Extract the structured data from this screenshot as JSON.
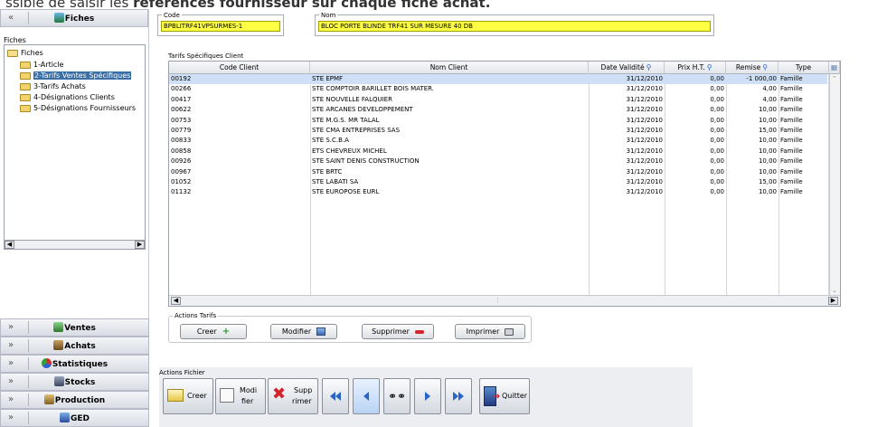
{
  "caption": {
    "prefix": "ssible de saisir les",
    "bold": "références fournisseur",
    "suffix": " sur chaque fiche achat."
  },
  "sidebar": {
    "top_section": {
      "title": "Fiches",
      "chevron": "«"
    },
    "tree_label": "Fiches",
    "tree": {
      "root": "Fiches",
      "items": [
        {
          "label": "1-Article"
        },
        {
          "label": "2-Tarifs Ventes Spécifiques",
          "selected": true
        },
        {
          "label": "3-Tarifs Achats"
        },
        {
          "label": "4-Désignations Clients"
        },
        {
          "label": "5-Désignations Fournisseurs"
        }
      ]
    },
    "sections": [
      {
        "title": "Ventes",
        "chevron": "»",
        "icon": "sales-icon"
      },
      {
        "title": "Achats",
        "chevron": "»",
        "icon": "purchases-icon"
      },
      {
        "title": "Statistiques",
        "chevron": "»",
        "icon": "stats-icon"
      },
      {
        "title": "Stocks",
        "chevron": "»",
        "icon": "stocks-icon"
      },
      {
        "title": "Production",
        "chevron": "»",
        "icon": "production-icon"
      },
      {
        "title": "GED",
        "chevron": "»",
        "icon": "ged-icon"
      }
    ]
  },
  "form": {
    "code": {
      "label": "Code",
      "value": "BPBLITRF41VPSURMES-1"
    },
    "nom": {
      "label": "Nom",
      "value": "BLOC PORTE BLINDE TRF41 SUR MESURE 40 DB"
    }
  },
  "grid": {
    "title": "Tarifs Spécifiques Client",
    "columns": [
      "Code Client",
      "Nom Client",
      "Date Validité",
      "Prix H.T.",
      "Remise",
      "Type"
    ],
    "rows": [
      [
        "00192",
        "STE EPMF",
        "31/12/2010",
        "0,00",
        "-1 000,00",
        "Famille"
      ],
      [
        "00266",
        "STE COMPTOIR BARILLET BOIS MATER.",
        "31/12/2010",
        "0,00",
        "4,00",
        "Famille"
      ],
      [
        "00417",
        "STE NOUVELLE FALQUIER",
        "31/12/2010",
        "0,00",
        "4,00",
        "Famille"
      ],
      [
        "00622",
        "STE ARCANES DEVELOPPEMENT",
        "31/12/2010",
        "0,00",
        "10,00",
        "Famille"
      ],
      [
        "00753",
        "STE M.G.S. MR TALAL",
        "31/12/2010",
        "0,00",
        "10,00",
        "Famille"
      ],
      [
        "00779",
        "STE CMA ENTREPRISES SAS",
        "31/12/2010",
        "0,00",
        "15,00",
        "Famille"
      ],
      [
        "00833",
        "STE S.C.B.A",
        "31/12/2010",
        "0,00",
        "10,00",
        "Famille"
      ],
      [
        "00858",
        "ETS CHEVREUX MICHEL",
        "31/12/2010",
        "0,00",
        "10,00",
        "Famille"
      ],
      [
        "00926",
        "STE SAINT DENIS CONSTRUCTION",
        "31/12/2010",
        "0,00",
        "10,00",
        "Famille"
      ],
      [
        "00967",
        "STE BRTC",
        "31/12/2010",
        "0,00",
        "10,00",
        "Famille"
      ],
      [
        "01052",
        "STE LABATI SA",
        "31/12/2010",
        "0,00",
        "15,00",
        "Famille"
      ],
      [
        "01132",
        "STE EUROPOSE EURL",
        "31/12/2010",
        "0,00",
        "10,00",
        "Famille"
      ]
    ]
  },
  "actions_tarifs": {
    "legend": "Actions Tarifs",
    "creer": "Creer",
    "modifier": "Modifier",
    "supprimer": "Supprimer",
    "imprimer": "Imprimer"
  },
  "actions_fichier": {
    "legend": "Actions Fichier",
    "creer": "Creer",
    "modifier_l1": "Modi",
    "modifier_l2": "fier",
    "supprimer_l1": "Supp",
    "supprimer_l2": "rimer",
    "quitter": "Quitter"
  },
  "colors": {
    "highlight_field": "#ffff44",
    "selected_row": "#cfe0f6",
    "accent": "#2a64c8",
    "delete_red": "#d6202a",
    "add_green": "#2a9a2a"
  }
}
